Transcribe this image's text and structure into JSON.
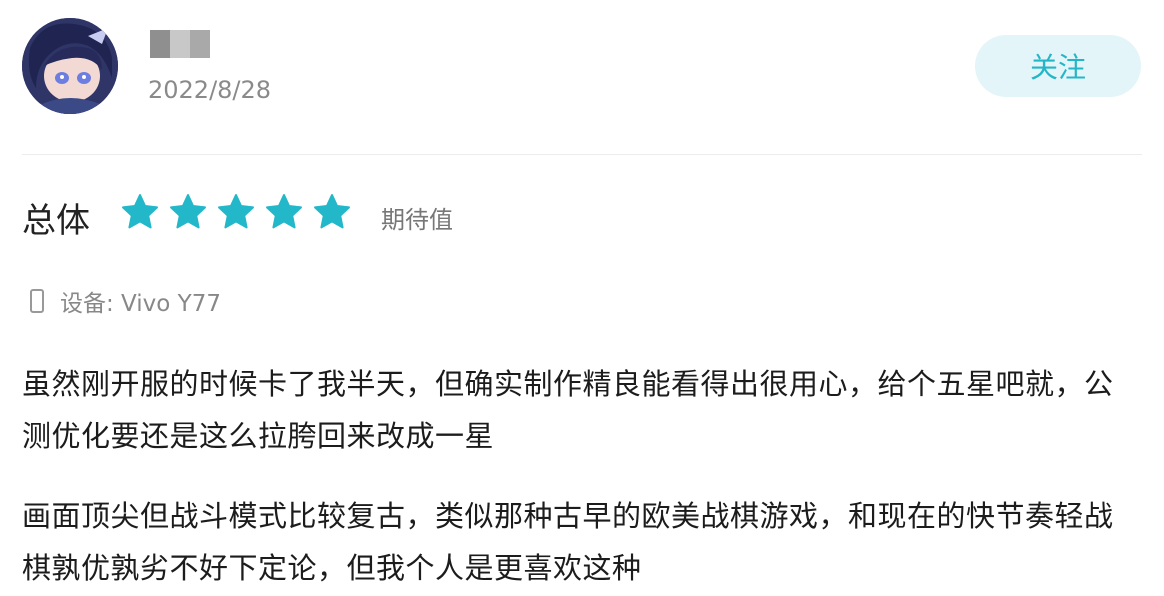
{
  "user": {
    "date": "2022/8/28"
  },
  "follow_label": "关注",
  "rating": {
    "label": "总体",
    "stars": 5,
    "max": 5,
    "tag": "期待值",
    "star_color": "#22b8c9"
  },
  "device": {
    "label": "设备: Vivo Y77"
  },
  "review": {
    "paragraphs": [
      "虽然刚开服的时候卡了我半天，但确实制作精良能看得出很用心，给个五星吧就，公测优化要还是这么拉胯回来改成一星",
      "画面顶尖但战斗模式比较复古，类似那种古早的欧美战棋游戏，和现在的快节奏轻战棋孰优孰劣不好下定论，但我个人是更喜欢这种"
    ]
  },
  "colors": {
    "accent": "#24b6c7",
    "follow_bg": "#e3f5f8"
  }
}
